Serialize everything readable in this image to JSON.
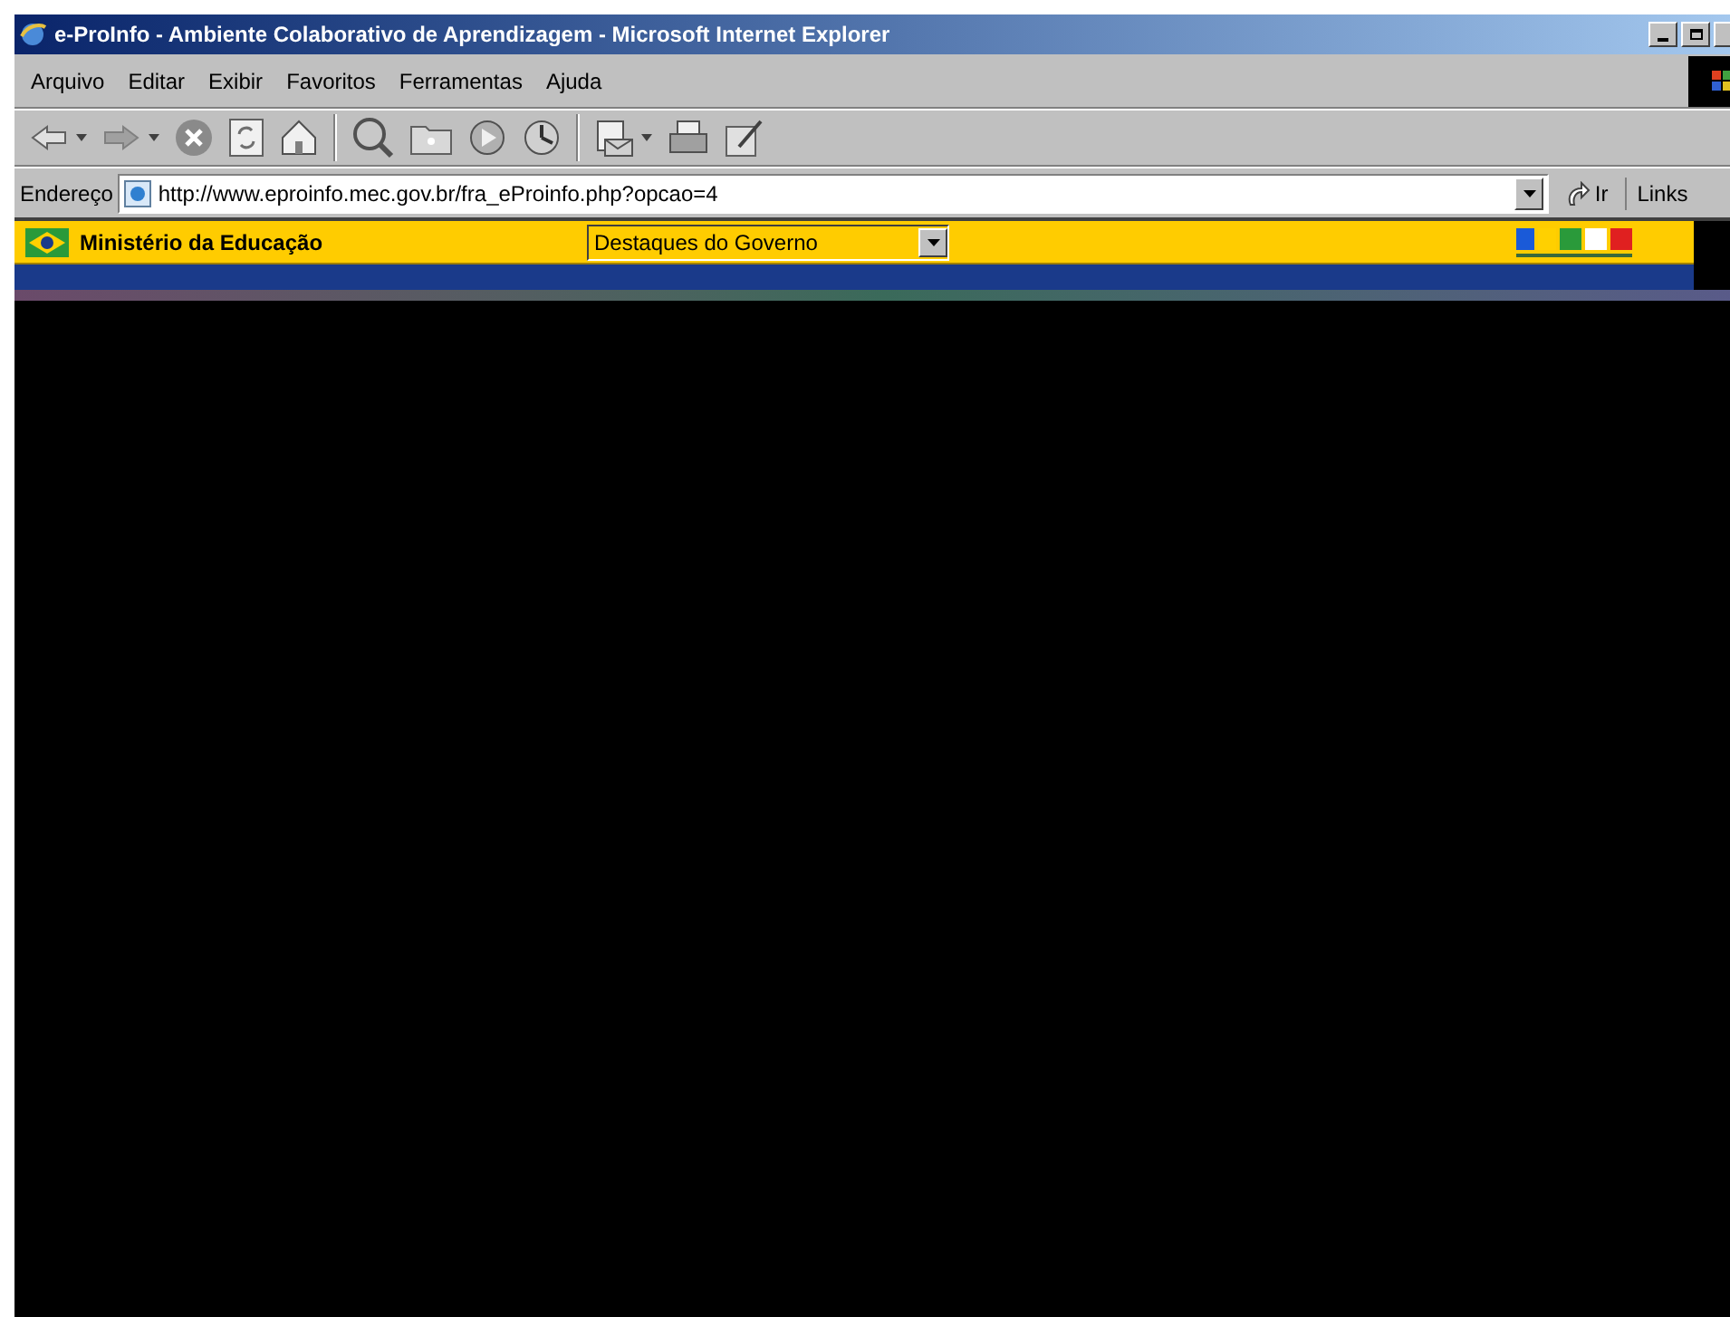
{
  "window": {
    "title": "e-ProInfo - Ambiente Colaborativo de Aprendizagem - Microsoft Internet Explorer"
  },
  "menu": [
    "Arquivo",
    "Editar",
    "Exibir",
    "Favoritos",
    "Ferramentas",
    "Ajuda"
  ],
  "toolbar": [
    {
      "kind": "back"
    },
    {
      "kind": "forward"
    },
    {
      "kind": "stop"
    },
    {
      "kind": "refresh"
    },
    {
      "kind": "home"
    },
    {
      "kind": "sep"
    },
    {
      "kind": "search"
    },
    {
      "kind": "favorites"
    },
    {
      "kind": "media"
    },
    {
      "kind": "history"
    },
    {
      "kind": "sep"
    },
    {
      "kind": "mail"
    },
    {
      "kind": "print"
    },
    {
      "kind": "edit"
    }
  ],
  "address": {
    "label": "Endereço",
    "value": "http://www.eproinfo.mec.gov.br/fra_eProinfo.php?opcao=4",
    "go": "Ir",
    "links": "Links"
  },
  "page": {
    "ministry": "Ministério da Educação",
    "select": "Destaques do Governo"
  }
}
